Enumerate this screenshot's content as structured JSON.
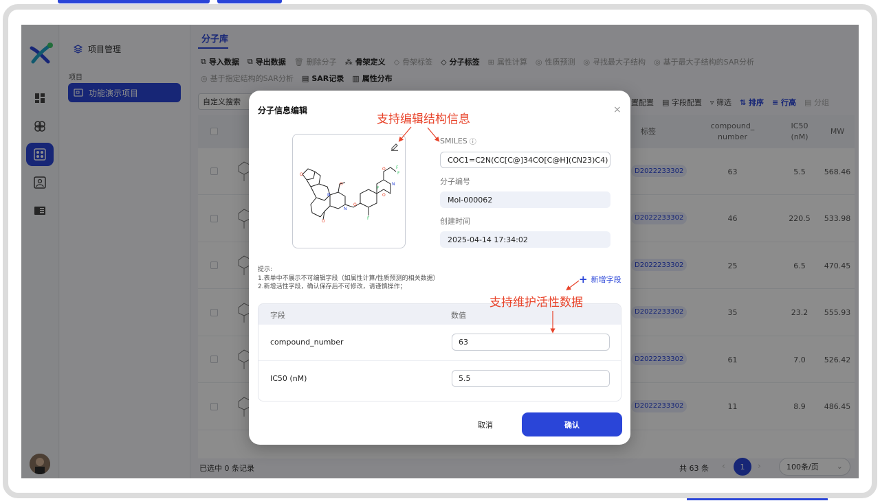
{
  "colors": {
    "primary": "#2a45d8",
    "annotation": "#e8432a"
  },
  "rail": {
    "icons": [
      "dashboard-icon",
      "molecule-icon",
      "analysis-icon",
      "user-card-icon",
      "book-icon"
    ],
    "active_index": 2
  },
  "project_panel": {
    "header": "项目管理",
    "section_label": "项目",
    "active_project": "功能演示项目"
  },
  "main": {
    "tab": "分子库",
    "toolbar": [
      {
        "label": "导入数据",
        "enabled": true
      },
      {
        "label": "导出数据",
        "enabled": true
      },
      {
        "label": "删除分子",
        "enabled": false
      },
      {
        "label": "骨架定义",
        "enabled": true
      },
      {
        "label": "骨架标签",
        "enabled": false
      },
      {
        "label": "分子标签",
        "enabled": true
      },
      {
        "label": "属性计算",
        "enabled": false
      },
      {
        "label": "性质预测",
        "enabled": false
      },
      {
        "label": "寻找最大子结构",
        "enabled": false
      },
      {
        "label": "基于最大子结构的SAR分析",
        "enabled": false
      },
      {
        "label": "基于指定结构的SAR分析",
        "enabled": false
      },
      {
        "label": "SAR记录",
        "enabled": true
      },
      {
        "label": "属性分布",
        "enabled": true
      }
    ],
    "search_label": "自定义搜索",
    "table_tools": {
      "display_config": "置配置",
      "field_config": "字段配置",
      "filter": "筛选",
      "sort": "排序",
      "row_height": "行高",
      "group": "分组"
    },
    "columns": {
      "tag": "标签",
      "compound_number": "compound_ number",
      "ic50": "IC50 (nM)",
      "mw": "MW"
    },
    "rows": [
      {
        "tag": "D2022233302",
        "compound_number": "63",
        "ic50": "5.5",
        "mw": "568.46"
      },
      {
        "tag": "D2022233302",
        "compound_number": "46",
        "ic50": "220.5",
        "mw": "533.98"
      },
      {
        "tag": "D2022233302",
        "compound_number": "25",
        "ic50": "6.5",
        "mw": "470.45"
      },
      {
        "tag": "D2022233302",
        "compound_number": "35",
        "ic50": "23.2",
        "mw": "555.93"
      },
      {
        "tag": "D2022233302",
        "compound_number": "61",
        "ic50": "7.0",
        "mw": "526.42"
      },
      {
        "tag": "D2022233302",
        "compound_number": "11",
        "ic50": "8.9",
        "mw": "486.45"
      }
    ],
    "footer": {
      "selected": "已选中 0 条记录",
      "total": "共 63 条",
      "current_page": "1",
      "page_size": "100条/页"
    }
  },
  "modal": {
    "title": "分子信息编辑",
    "smiles_label": "SMILES",
    "smiles_value": "COC1=C2N(CC[C@]34CO[C@H](CN23)C4)",
    "mol_id_label": "分子编号",
    "mol_id_value": "Mol-000062",
    "created_label": "创建时间",
    "created_value": "2025-04-14 17:34:02",
    "tips": [
      "提示:",
      "1.表单中不展示不可编辑字段（如属性计算/性质预测的相关数据）",
      "2.新增活性字段，确认保存后不可修改，请谨慎操作；"
    ],
    "add_field": "新增字段",
    "table": {
      "col_field": "字段",
      "col_value": "数值",
      "rows": [
        {
          "field": "compound_number",
          "value": "63"
        },
        {
          "field": "IC50 (nM)",
          "value": "5.5"
        }
      ]
    },
    "cancel": "取消",
    "confirm": "确认"
  },
  "annotations": {
    "edit_structure": "支持编辑结构信息",
    "maintain_activity": "支持维护活性数据"
  }
}
